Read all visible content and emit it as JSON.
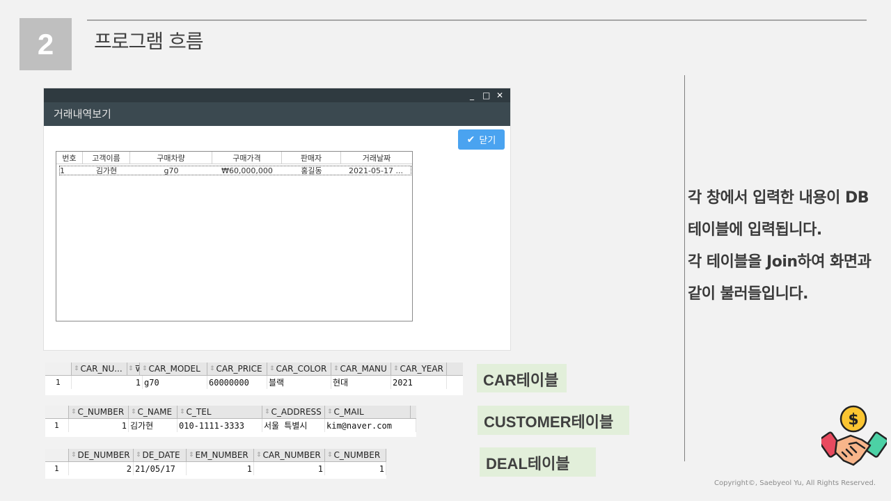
{
  "slide": {
    "number": "2",
    "title": "프로그램 흐름",
    "copyright": "Copyright©, Saebyeol Yu, All Rights Reserved."
  },
  "window": {
    "controls": [
      "_",
      "□",
      "✕"
    ],
    "title": "거래내역보기",
    "close_button": "닫기",
    "table": {
      "columns": [
        "번호",
        "고객이름",
        "구매차량",
        "구매가격",
        "판매자",
        "거래날짜"
      ],
      "rows": [
        [
          "1",
          "김가현",
          "g70",
          "₩60,000,000",
          "홍길동",
          "2021-05-17 ..."
        ]
      ]
    }
  },
  "description": [
    "각 창에서 입력한 내용이 DB",
    "테이블에 입력됩니다.",
    "각 테이블을 Join하여 화면과",
    "같이 불러들입니다."
  ],
  "car_table": {
    "label": "CAR테이블",
    "columns": [
      "CAR_NU...",
      "CAR_MODEL",
      "CAR_PRICE",
      "CAR_COLOR",
      "CAR_MANU",
      "CAR_YEAR"
    ],
    "row": [
      "1",
      "1",
      "g70",
      "60000000",
      "블랙",
      "현대",
      "2021"
    ]
  },
  "customer_table": {
    "label": "CUSTOMER테이블",
    "columns": [
      "C_NUMBER",
      "C_NAME",
      "C_TEL",
      "C_ADDRESS",
      "C_MAIL"
    ],
    "row": [
      "1",
      "1",
      "김가현",
      "010-1111-3333",
      "서울 특별시",
      "kim@naver.com"
    ]
  },
  "deal_table": {
    "label": "DEAL테이블",
    "columns": [
      "DE_NUMBER",
      "DE_DATE",
      "EM_NUMBER",
      "CAR_NUMBER",
      "C_NUMBER"
    ],
    "row": [
      "1",
      "2",
      "21/05/17",
      "1",
      "1",
      "1"
    ]
  }
}
